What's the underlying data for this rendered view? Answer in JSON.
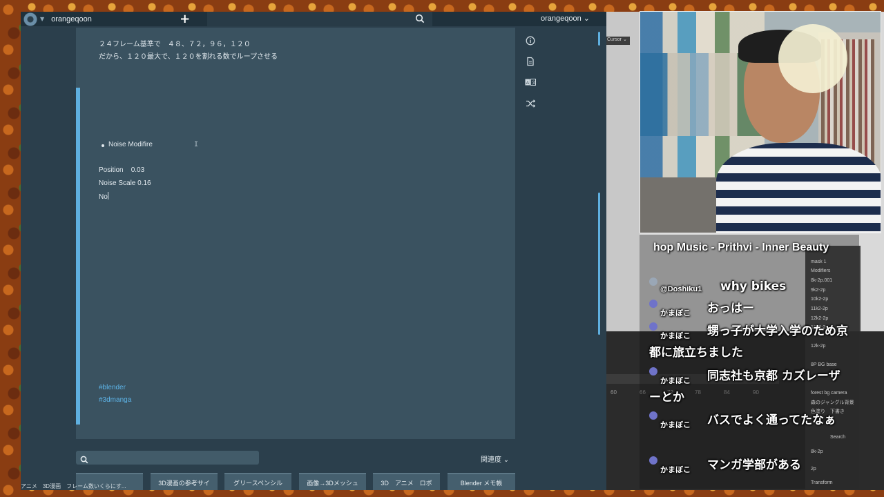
{
  "header": {
    "team_name": "orangeqoon",
    "user_name": "orangeqoon ⌄",
    "icons": [
      "logo-icon",
      "plus-icon",
      "search-icon"
    ]
  },
  "note": {
    "line1": "２４フレーム基準で　４８、７２，９６，１２０",
    "line2": "だから、１２０最大で、１２０を割れる数でループさせる",
    "bullet": "Noise Modifire",
    "position": "Position    0.03",
    "noise_scale": "Noise Scale 0.16",
    "typing": "No",
    "tags": [
      "#blender",
      "#3dmanga"
    ]
  },
  "rail_icons": [
    "info-icon",
    "document-icon",
    "translate-icon",
    "shuffle-icon"
  ],
  "bottom": {
    "search_placeholder": "",
    "sort_label": "関連度 ⌄",
    "status_text": "アニメ　3D漫画　フレーム数いくらにす...",
    "cards": [
      "",
      "3D漫画の参考サイ",
      "グリースペンシル",
      "画像→3Dメッシュ",
      "3D　アニメ　ロボ",
      "Blender メモ帳"
    ]
  },
  "background_app": {
    "cursor_chip": "Cursor ⌄",
    "timeline_numbers": [
      "60",
      "66",
      "72",
      "78",
      "84",
      "90"
    ],
    "panel_rows": [
      "mask 1",
      "Modifiers",
      "8k-2p.001",
      "9k2-2p",
      "10k2-2p",
      "11k2-2p",
      "12k2-2p",
      "13k2-2p",
      "12k-2p",
      "8P BG base",
      "forest bg camera",
      "森のジャングル背景",
      "色塗り　下書き",
      "Search",
      "8k-2p",
      "2p",
      "Transform"
    ]
  },
  "stream": {
    "music_title": "hop Music - Prithvi - Inner Beauty",
    "messages": [
      {
        "user": "@Doshiku1",
        "text": "why bikes"
      },
      {
        "user": "かまぼこ",
        "text": "おっはー"
      },
      {
        "user": "かまぼこ",
        "text": "甥っ子が大学入学のため京都に旅立ちました"
      },
      {
        "user": "かまぼこ",
        "text": "同志社も京都 カズレーザーとか"
      },
      {
        "user": "かまぼこ",
        "text": "バスでよく通ってたなぁ"
      },
      {
        "user": "かまぼこ",
        "text": "マンガ学部がある"
      }
    ]
  },
  "colors": {
    "app_bg": "#2b3f4c",
    "editor_bg": "#3a5260",
    "accent": "#5fb0e0",
    "tag": "#5db4e8"
  }
}
